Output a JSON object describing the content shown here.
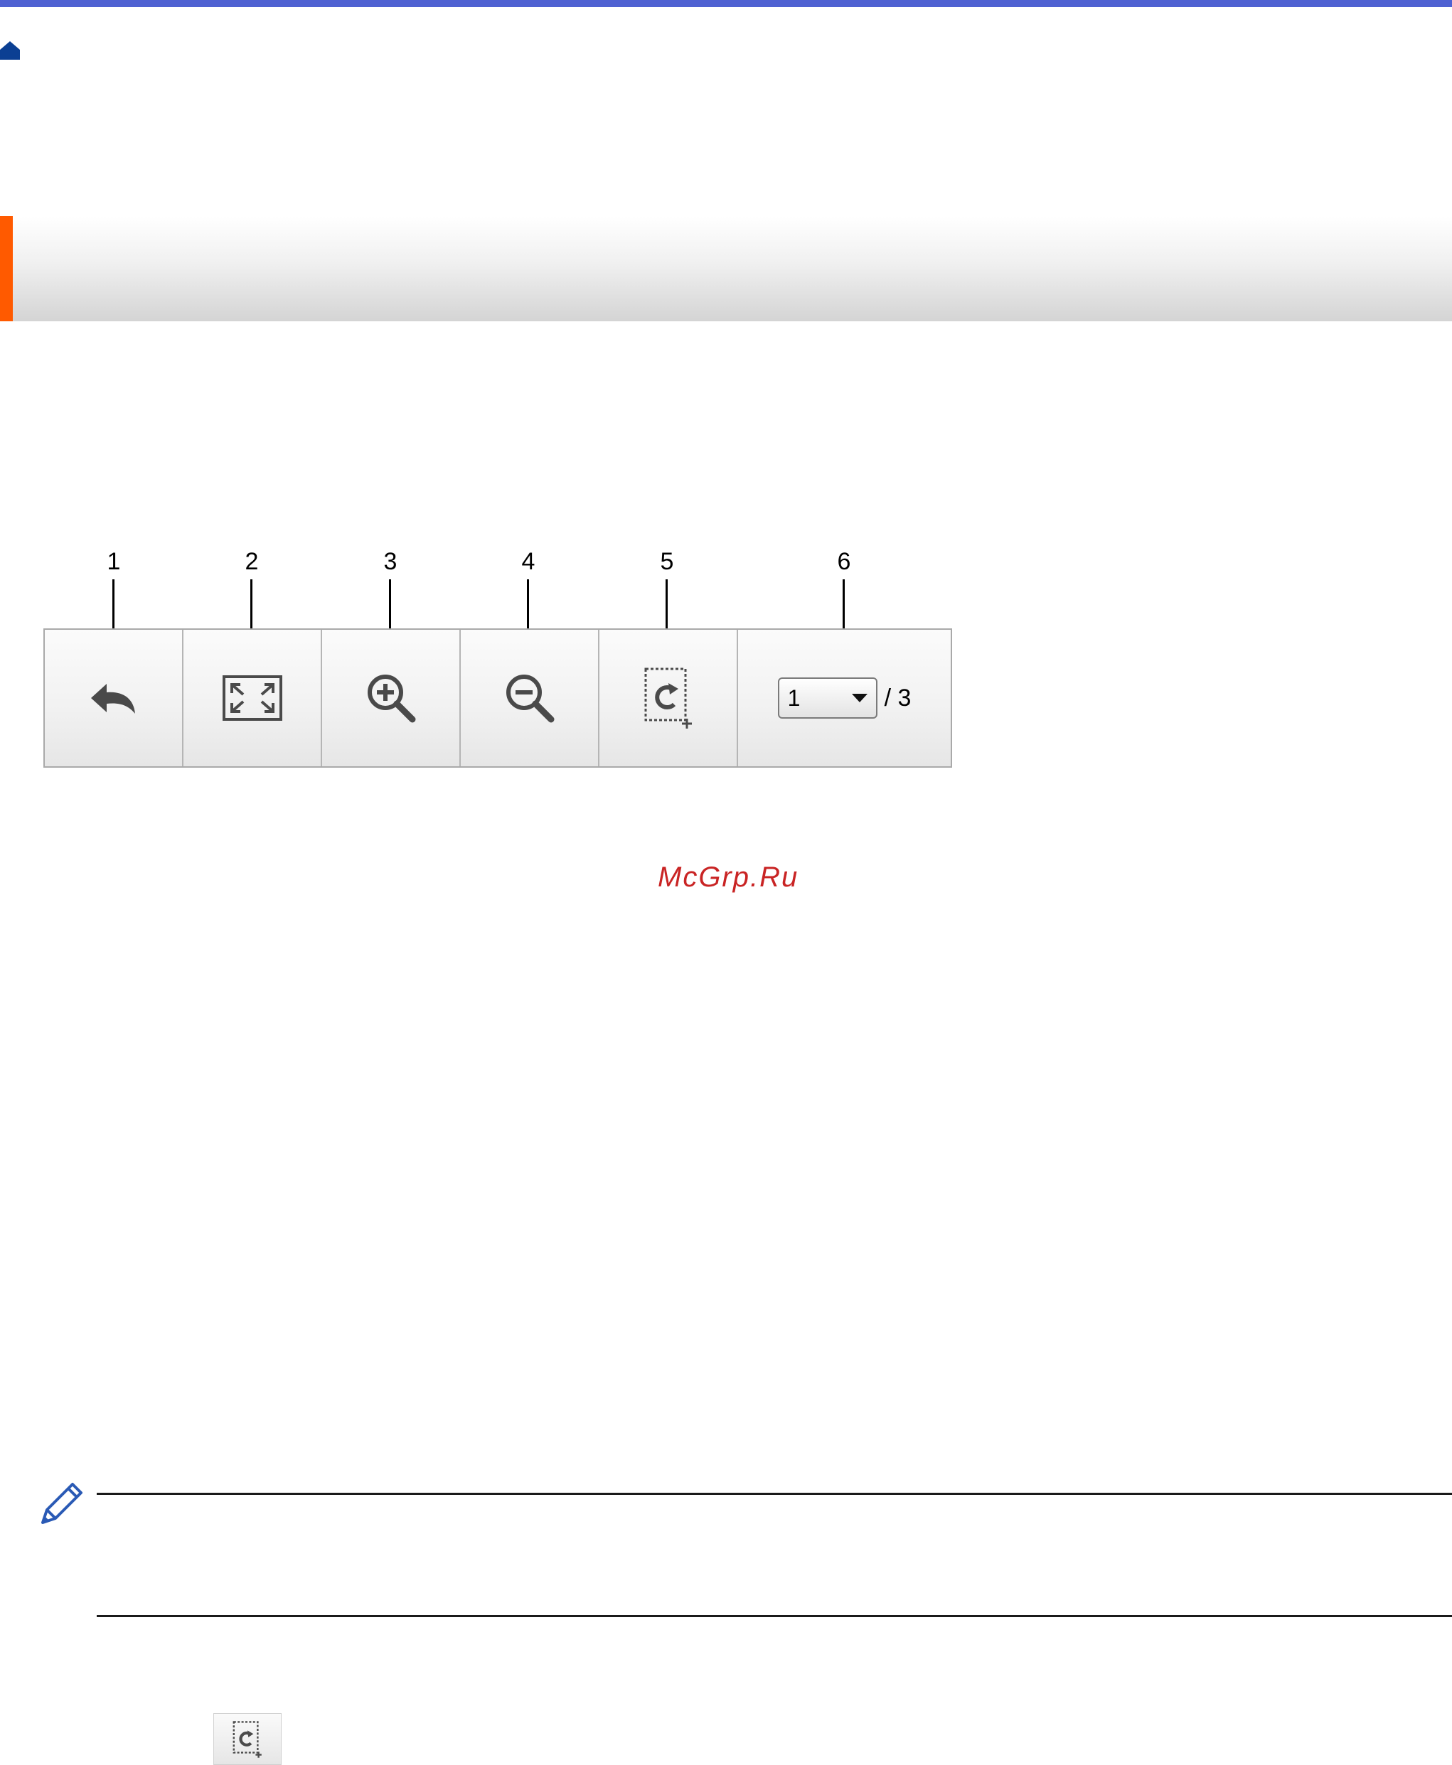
{
  "colors": {
    "top_bar": "#4f61d2",
    "home_icon": "#0b3f93",
    "header_accent": "#ff5a00",
    "watermark": "#c92424",
    "pencil_icon": "#2a5ab5"
  },
  "callouts": [
    "1",
    "2",
    "3",
    "4",
    "5",
    "6"
  ],
  "toolbar": {
    "buttons": [
      {
        "icon": "undo-arrow-icon"
      },
      {
        "icon": "fit-to-screen-icon"
      },
      {
        "icon": "zoom-in-icon"
      },
      {
        "icon": "zoom-out-icon"
      },
      {
        "icon": "rotate-crop-icon"
      }
    ],
    "page_select": {
      "selected": "1",
      "total": "/ 3"
    }
  },
  "watermark": "McGrp.Ru",
  "note": {
    "icon": "pencil-icon"
  },
  "small_button": {
    "icon": "rotate-crop-icon"
  }
}
